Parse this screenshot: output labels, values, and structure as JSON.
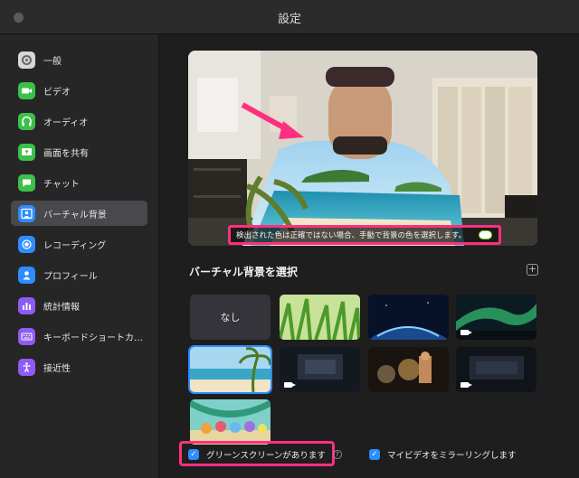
{
  "window": {
    "title": "設定"
  },
  "sidebar": {
    "items": [
      {
        "label": "一般",
        "icon": "gear-icon",
        "color": "#d8d8d8"
      },
      {
        "label": "ビデオ",
        "icon": "video-icon",
        "color": "#3cc04a"
      },
      {
        "label": "オーディオ",
        "icon": "headphones-icon",
        "color": "#3cc04a"
      },
      {
        "label": "画面を共有",
        "icon": "share-screen-icon",
        "color": "#3cc04a"
      },
      {
        "label": "チャット",
        "icon": "chat-icon",
        "color": "#3cc04a"
      },
      {
        "label": "バーチャル背景",
        "icon": "virtual-background-icon",
        "color": "#2d8cff"
      },
      {
        "label": "レコーディング",
        "icon": "record-icon",
        "color": "#2d8cff"
      },
      {
        "label": "プロフィール",
        "icon": "profile-icon",
        "color": "#2d8cff"
      },
      {
        "label": "統計情報",
        "icon": "statistics-icon",
        "color": "#8e5cf5"
      },
      {
        "label": "キーボードショートカ…",
        "icon": "keyboard-icon",
        "color": "#8e5cf5"
      },
      {
        "label": "接近性",
        "icon": "accessibility-icon",
        "color": "#8e5cf5"
      }
    ],
    "active_index": 5
  },
  "preview": {
    "warning_text": "検出された色は正確ではない場合、手動で背景の色を選択します。",
    "accent_color": "#ff2f80"
  },
  "virtual_bg": {
    "section_title": "バーチャル背景を選択",
    "add_label": "+",
    "none_label": "なし",
    "selected_index": 4
  },
  "options": {
    "green_screen_label": "グリーンスクリーンがあります",
    "green_screen_checked": true,
    "mirror_label": "マイビデオをミラーリングします",
    "mirror_checked": true,
    "help_glyph": "?"
  }
}
